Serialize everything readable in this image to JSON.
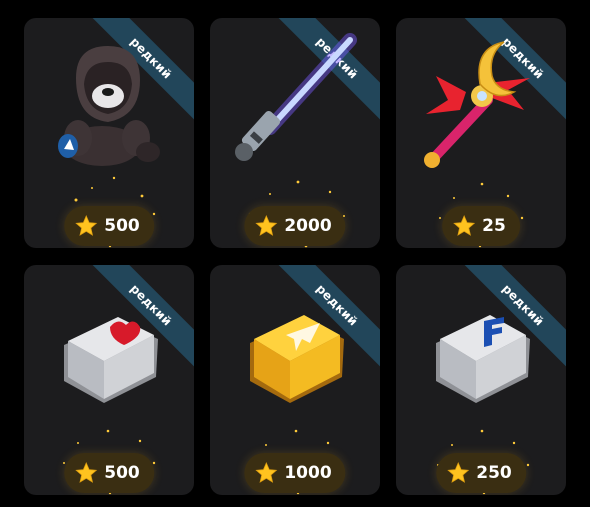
{
  "cards": [
    {
      "badge": "редкий",
      "item_icon": "hooded-teddy-bear-icon",
      "price": "500"
    },
    {
      "badge": "редкий",
      "item_icon": "lightsaber-icon",
      "price": "2000"
    },
    {
      "badge": "редкий",
      "item_icon": "moon-wand-icon",
      "price": "25"
    },
    {
      "badge": "редкий",
      "item_icon": "heart-keycap-icon",
      "price": "500"
    },
    {
      "badge": "редкий",
      "item_icon": "gold-plane-keycap-icon",
      "price": "1000"
    },
    {
      "badge": "редкий",
      "item_icon": "letter-f-keycap-icon",
      "price": "250"
    }
  ],
  "colors": {
    "card_bg": "#1c1c1e",
    "badge_bg": "#22465a",
    "price_pill_bg": "#3a2e12",
    "star": "#ffc31f"
  }
}
